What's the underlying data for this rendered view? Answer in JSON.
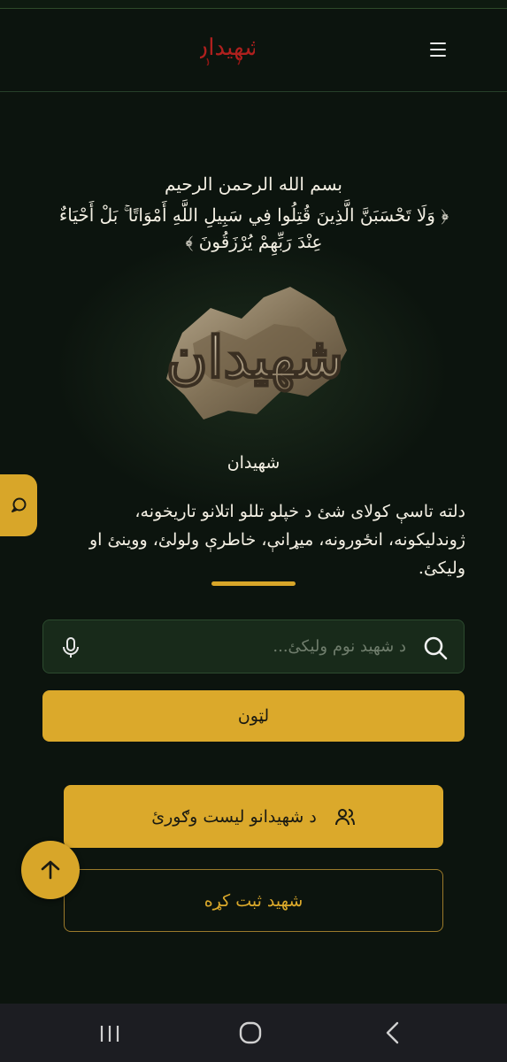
{
  "header": {
    "logo_text": "شهیدان",
    "menu_icon": "hamburger-menu-icon"
  },
  "hero": {
    "bismillah": "بسم الله الرحمن الرحیم",
    "verse": "﴿ وَلَا تَحْسَبَنَّ الَّذِينَ قُتِلُوا فِي سَبِيلِ اللَّهِ أَمْوَاتًا ۚ بَلْ أَحْيَاءٌ عِنْدَ رَبِّهِمْ يُرْزَقُونَ ﴾",
    "logo_text": "شهیدان",
    "site_name": "شهیدان",
    "description": "دلته تاسې کولای شئ د خپلو تللو اتلانو تاریخونه، ژوندلیکونه، انځورونه، میړانې، خاطرې ولولئ، ووینئ او ولیکئ."
  },
  "search": {
    "placeholder": "د شهید نوم ولیکئ...",
    "value": "",
    "submit_label": "لټون"
  },
  "actions": {
    "list_label": "د شهیدانو لیست وګورئ",
    "register_label": "شهید ثبت کړه"
  },
  "colors": {
    "background": "#0c140e",
    "accent_gold": "#dba92b",
    "logo_red": "#b0201e"
  }
}
